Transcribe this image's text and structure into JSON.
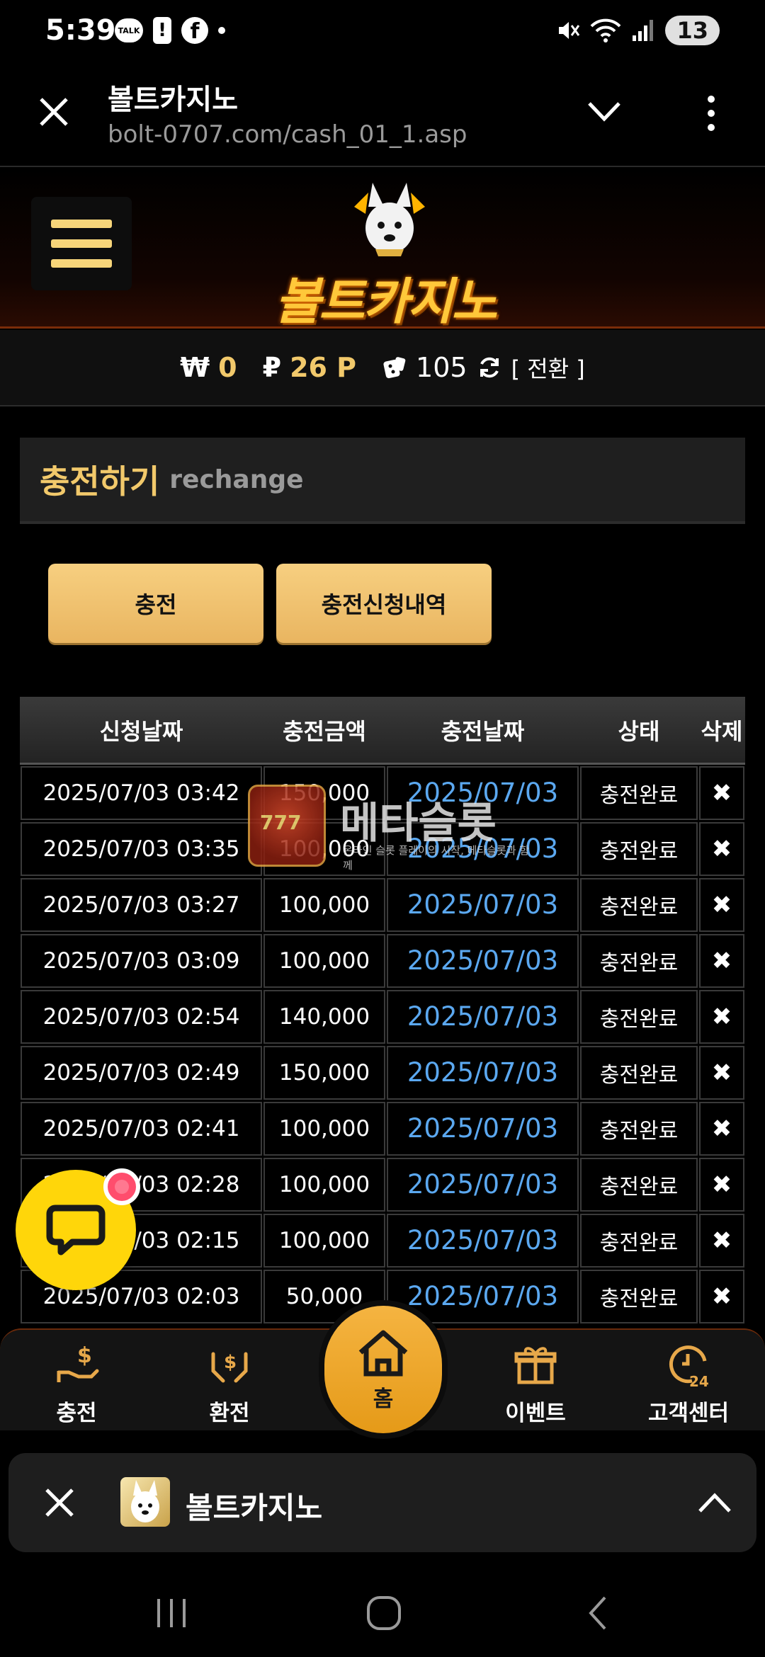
{
  "status_bar": {
    "time": "5:39",
    "talk_label": "TALK",
    "battery": "13"
  },
  "browser": {
    "title": "볼트카지노",
    "url": "bolt-0707.com/cash_01_1.asp"
  },
  "site": {
    "logo_text": "볼트카지노"
  },
  "balance": {
    "won_symbol": "₩",
    "won_value": "0",
    "point_symbol": "₽",
    "point_value": "26 P",
    "chip_value": "105",
    "switch_label": "[ 전환 ]"
  },
  "section": {
    "title": "충전하기",
    "subtitle": "rechange"
  },
  "buttons": {
    "charge": "충전",
    "history": "충전신청내역"
  },
  "table": {
    "headers": [
      "신청날짜",
      "충전금액",
      "충전날짜",
      "상태",
      "삭제"
    ],
    "rows": [
      {
        "requested": "2025/07/03 03:42",
        "amount": "150,000",
        "charged": "2025/07/03",
        "status": "충전완료"
      },
      {
        "requested": "2025/07/03 03:35",
        "amount": "100,000",
        "charged": "2025/07/03",
        "status": "충전완료"
      },
      {
        "requested": "2025/07/03 03:27",
        "amount": "100,000",
        "charged": "2025/07/03",
        "status": "충전완료"
      },
      {
        "requested": "2025/07/03 03:09",
        "amount": "100,000",
        "charged": "2025/07/03",
        "status": "충전완료"
      },
      {
        "requested": "2025/07/03 02:54",
        "amount": "140,000",
        "charged": "2025/07/03",
        "status": "충전완료"
      },
      {
        "requested": "2025/07/03 02:49",
        "amount": "150,000",
        "charged": "2025/07/03",
        "status": "충전완료"
      },
      {
        "requested": "2025/07/03 02:41",
        "amount": "100,000",
        "charged": "2025/07/03",
        "status": "충전완료"
      },
      {
        "requested": "2025/07/03 02:28",
        "amount": "100,000",
        "charged": "2025/07/03",
        "status": "충전완료"
      },
      {
        "requested": "2025/07/03 02:15",
        "amount": "100,000",
        "charged": "2025/07/03",
        "status": "충전완료"
      },
      {
        "requested": "2025/07/03 02:03",
        "amount": "50,000",
        "charged": "2025/07/03",
        "status": "충전완료"
      }
    ],
    "delete_symbol": "✖"
  },
  "watermark": {
    "badge": "777",
    "title": "메타슬롯",
    "subtitle": "온라인 슬롯 플레이의 시작, 메타슬롯과 함께"
  },
  "bottom_nav": {
    "items": [
      {
        "label": "충전",
        "icon": "deposit-hand-icon"
      },
      {
        "label": "환전",
        "icon": "exchange-hands-icon"
      },
      {
        "label": "홈",
        "icon": "home-icon"
      },
      {
        "label": "이벤트",
        "icon": "gift-icon"
      },
      {
        "label": "고객센터",
        "icon": "support-24-icon"
      }
    ]
  },
  "tab_sheet": {
    "title": "볼트카지노"
  },
  "colors": {
    "accent_gold": "#f2c96b",
    "link_blue": "#5ba8f0",
    "chat_yellow": "#ffd60a",
    "home_orange": "#e59a18"
  }
}
